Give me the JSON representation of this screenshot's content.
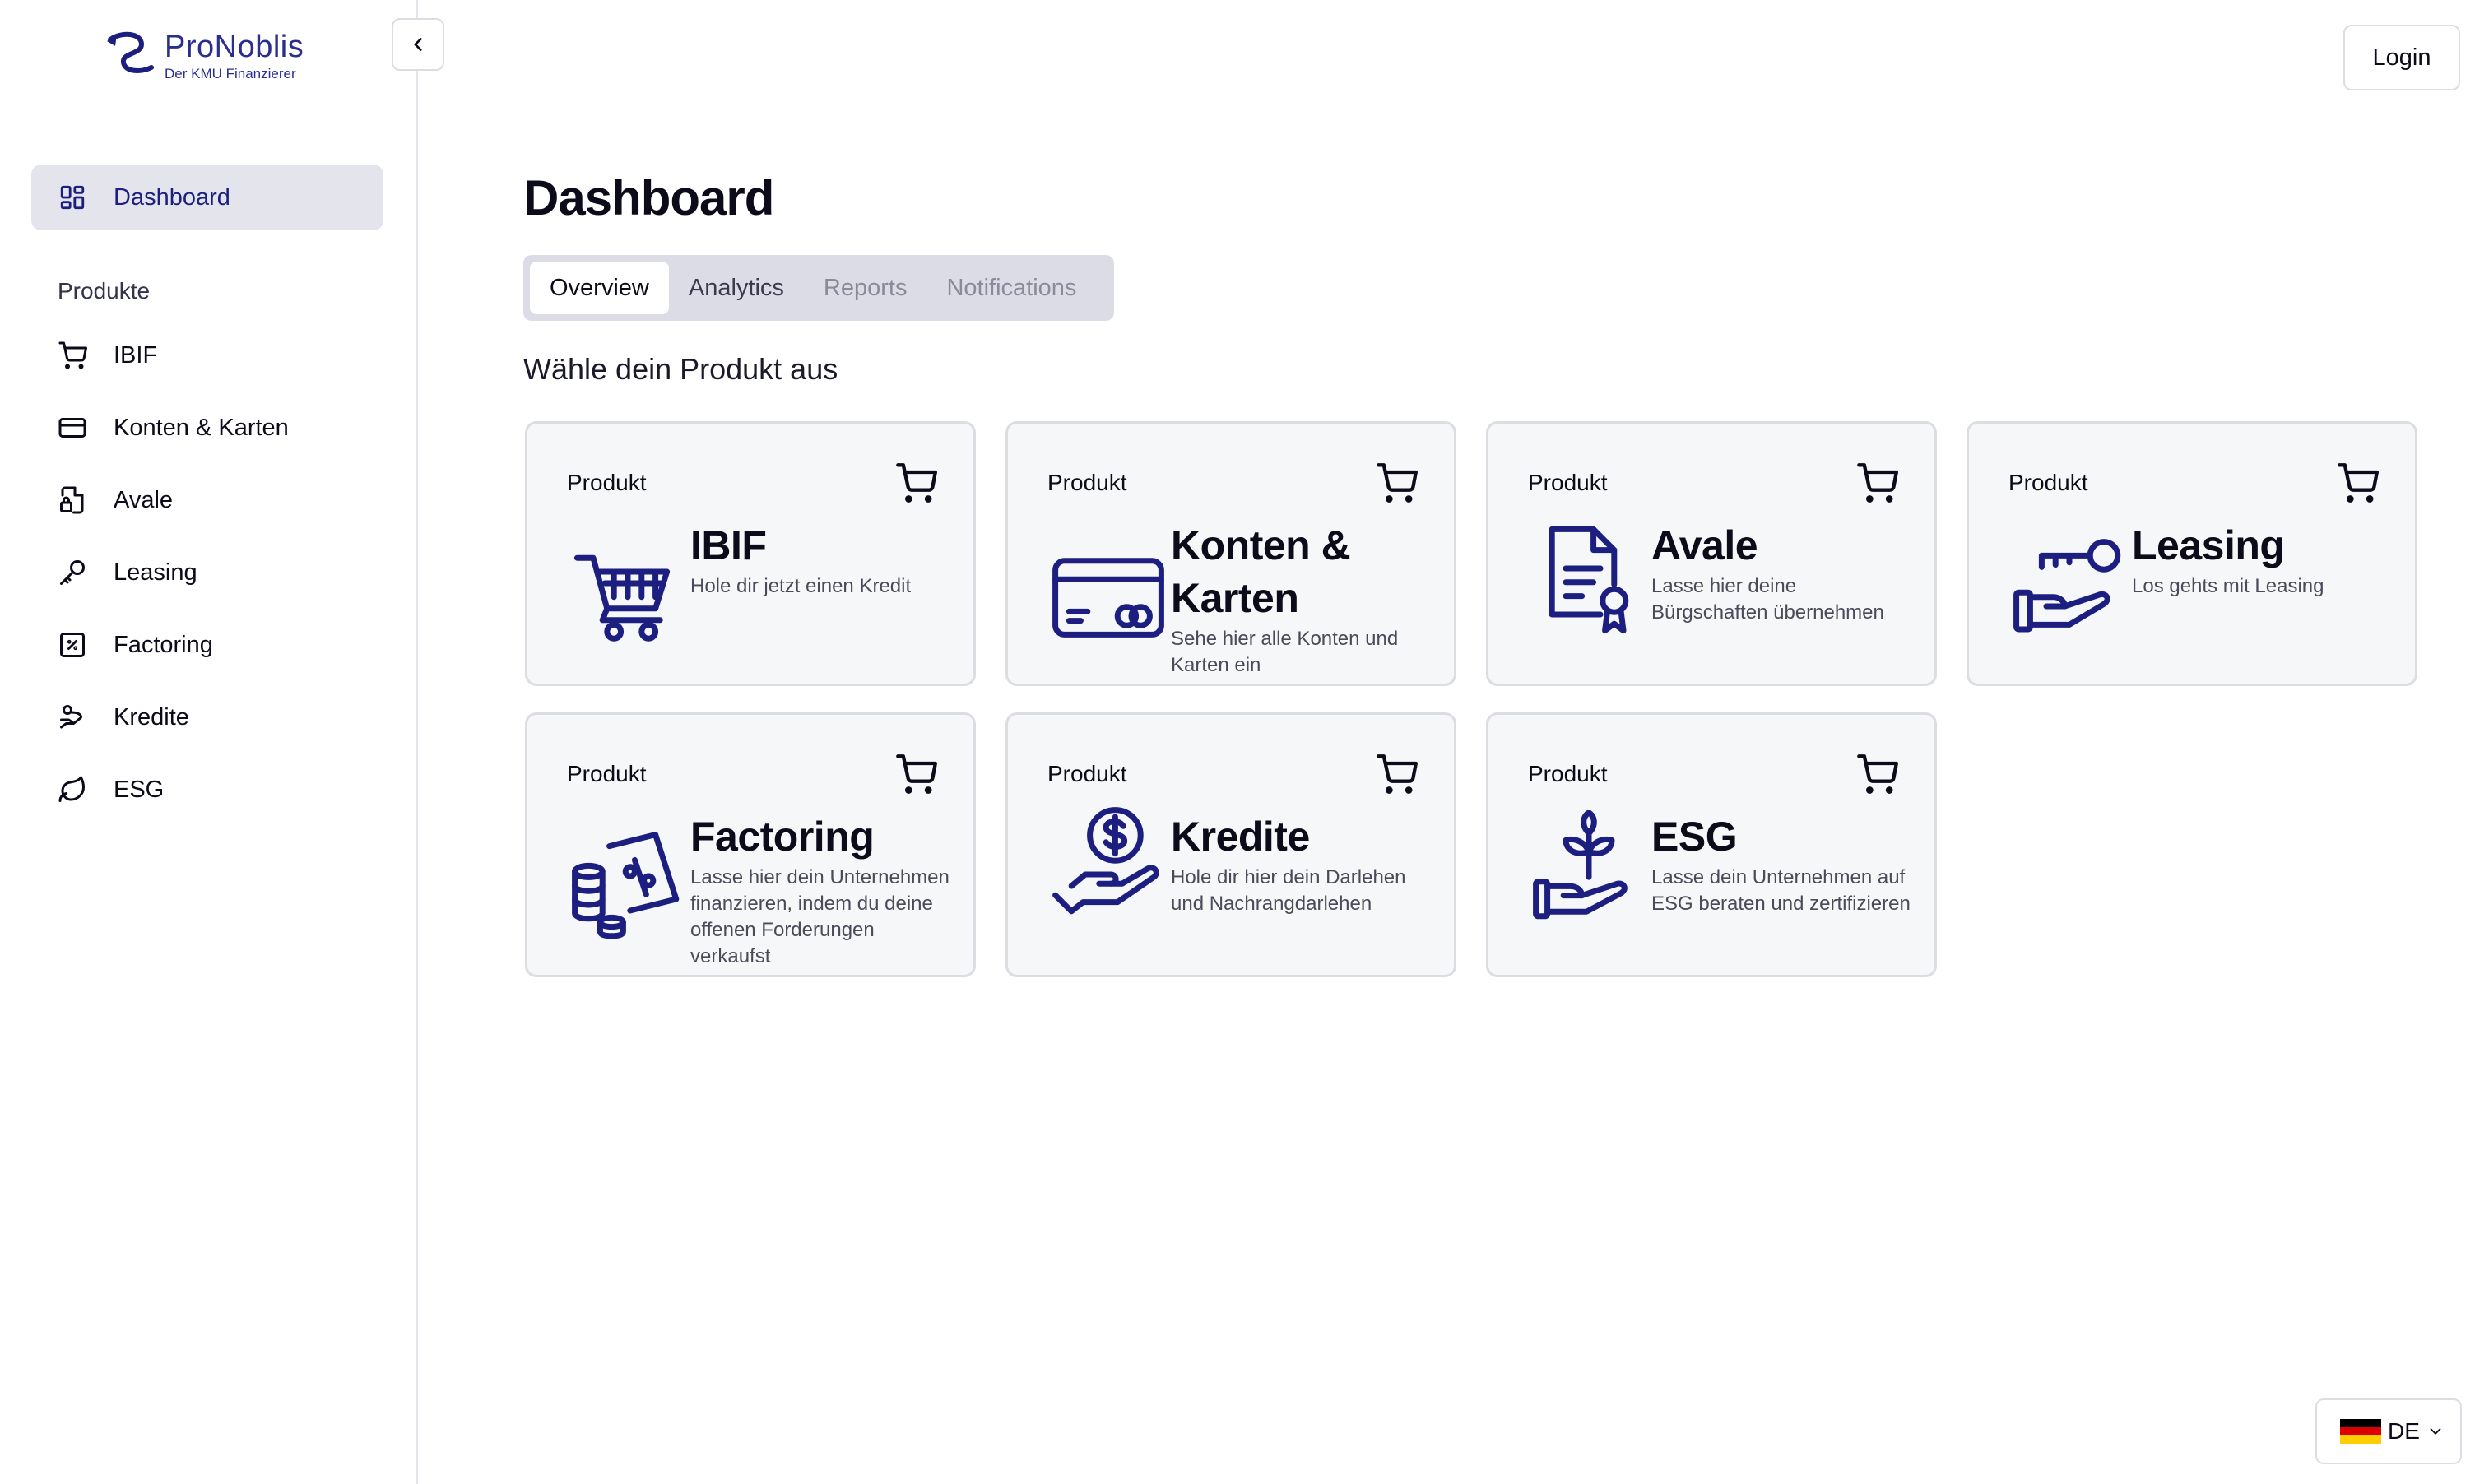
{
  "brand": {
    "name": "ProNoblis",
    "tagline": "Der KMU Finanzierer",
    "color": "#2b2e8f"
  },
  "sidebar": {
    "collapse_icon": "chevron-left-icon",
    "active_item": {
      "label": "Dashboard",
      "icon": "dashboard-grid-icon"
    },
    "section_label": "Produkte",
    "items": [
      {
        "label": "IBIF",
        "icon": "cart-icon"
      },
      {
        "label": "Konten & Karten",
        "icon": "credit-card-icon"
      },
      {
        "label": "Avale",
        "icon": "document-lock-icon"
      },
      {
        "label": "Leasing",
        "icon": "key-icon"
      },
      {
        "label": "Factoring",
        "icon": "percent-square-icon"
      },
      {
        "label": "Kredite",
        "icon": "hand-coins-icon"
      },
      {
        "label": "ESG",
        "icon": "leaf-icon"
      }
    ]
  },
  "header": {
    "login_label": "Login"
  },
  "main": {
    "title": "Dashboard",
    "tabs": [
      {
        "label": "Overview",
        "state": "active"
      },
      {
        "label": "Analytics",
        "state": "normal"
      },
      {
        "label": "Reports",
        "state": "disabled"
      },
      {
        "label": "Notifications",
        "state": "disabled"
      }
    ],
    "subtitle": "Wähle dein Produkt aus",
    "card_tag": "Produkt",
    "cards": [
      {
        "title": "IBIF",
        "description": "Hole dir jetzt einen Kredit",
        "icon": "shopping-cart-illustration"
      },
      {
        "title": "Konten & Karten",
        "description": "Sehe hier alle Konten und Karten ein",
        "icon": "credit-card-illustration"
      },
      {
        "title": "Avale",
        "description": "Lasse hier deine Bürgschaften übernehmen",
        "icon": "certificate-illustration"
      },
      {
        "title": "Leasing",
        "description": "Los gehts mit Leasing",
        "icon": "hand-key-illustration"
      },
      {
        "title": "Factoring",
        "description": "Lasse hier dein Unternehmen finanzieren, indem du deine offenen Forderungen verkaufst",
        "icon": "coins-percent-illustration"
      },
      {
        "title": "Kredite",
        "description": "Hole dir hier dein Darlehen und Nachrangdarlehen",
        "icon": "hand-dollar-illustration"
      },
      {
        "title": "ESG",
        "description": "Lasse dein Unternehmen auf ESG beraten und zertifizieren",
        "icon": "hand-plant-illustration"
      }
    ]
  },
  "language": {
    "selected": "DE",
    "flag_colors": [
      "#000000",
      "#dd0000",
      "#ffce00"
    ]
  },
  "colors": {
    "accent": "#1c1f80",
    "card_bg": "#f6f7f9",
    "active_nav_bg": "#e4e4ec"
  }
}
